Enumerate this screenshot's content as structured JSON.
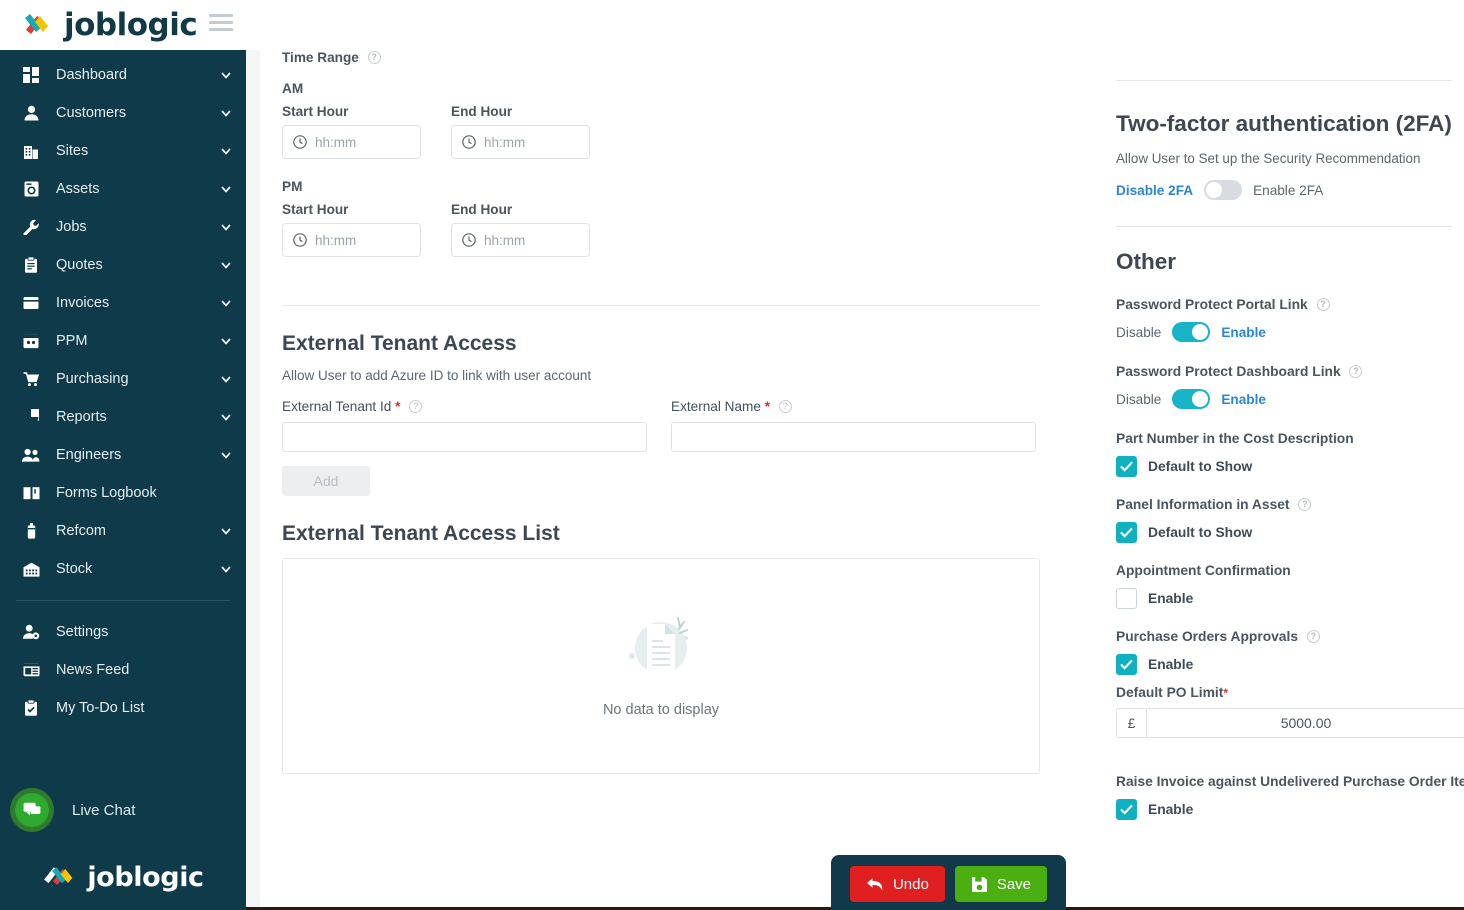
{
  "brand": {
    "name": "joblogic"
  },
  "topbar": {
    "menu_icon": "hamburger-icon"
  },
  "sidebar": {
    "items": [
      {
        "label": "Dashboard",
        "icon": "dashboard-icon",
        "expandable": true
      },
      {
        "label": "Customers",
        "icon": "user-icon",
        "expandable": true
      },
      {
        "label": "Sites",
        "icon": "building-icon",
        "expandable": true
      },
      {
        "label": "Assets",
        "icon": "asset-icon",
        "expandable": true
      },
      {
        "label": "Jobs",
        "icon": "wrench-icon",
        "expandable": true
      },
      {
        "label": "Quotes",
        "icon": "clipboard-icon",
        "expandable": true
      },
      {
        "label": "Invoices",
        "icon": "invoice-icon",
        "expandable": true
      },
      {
        "label": "PPM",
        "icon": "calendar-icon",
        "expandable": true
      },
      {
        "label": "Purchasing",
        "icon": "cart-icon",
        "expandable": true
      },
      {
        "label": "Reports",
        "icon": "pie-chart-icon",
        "expandable": true
      },
      {
        "label": "Engineers",
        "icon": "people-icon",
        "expandable": true
      },
      {
        "label": "Forms Logbook",
        "icon": "book-icon",
        "expandable": false
      },
      {
        "label": "Refcom",
        "icon": "cylinder-icon",
        "expandable": true
      },
      {
        "label": "Stock",
        "icon": "warehouse-icon",
        "expandable": true
      }
    ],
    "footer_items": [
      {
        "label": "Settings",
        "icon": "user-gear-icon",
        "expandable": false
      },
      {
        "label": "News Feed",
        "icon": "news-icon",
        "expandable": false
      },
      {
        "label": "My To-Do List",
        "icon": "todo-icon",
        "expandable": false
      }
    ],
    "live_chat": {
      "label": "Live Chat",
      "icon": "chat-icon"
    },
    "footer_logo": "joblogic"
  },
  "main": {
    "time_range": {
      "title": "Time Range",
      "am_label": "AM",
      "pm_label": "PM",
      "start_label": "Start Hour",
      "end_label": "End Hour",
      "placeholder": "hh:mm",
      "am_start_value": "",
      "am_end_value": "",
      "pm_start_value": "",
      "pm_end_value": ""
    },
    "external_tenant": {
      "title": "External Tenant Access",
      "subtitle": "Allow User to add Azure ID to link with user account",
      "tenant_id_label": "External Tenant Id",
      "tenant_id_value": "",
      "external_name_label": "External Name",
      "external_name_value": "",
      "required_marker": "*",
      "add_label": "Add"
    },
    "tenant_list": {
      "title": "External Tenant Access List",
      "empty_message": "No data to display",
      "empty_icon": "empty-document-icon"
    }
  },
  "right_panel": {
    "twofa": {
      "title": "Two-factor authentication (2FA)",
      "subtitle": "Allow User to Set up the Security Recommendation",
      "off_label": "Disable 2FA",
      "on_label": "Enable 2FA",
      "enabled": false
    },
    "other": {
      "title": "Other",
      "toggles": [
        {
          "label": "Password Protect Portal Link",
          "has_hint": true,
          "off_label": "Disable",
          "on_label": "Enable",
          "enabled": true
        },
        {
          "label": "Password Protect Dashboard Link",
          "has_hint": true,
          "off_label": "Disable",
          "on_label": "Enable",
          "enabled": true
        }
      ],
      "checkboxes": [
        {
          "label": "Part Number in the Cost Description",
          "has_hint": false,
          "option_label": "Default to Show",
          "checked": true
        },
        {
          "label": "Panel Information in Asset",
          "has_hint": true,
          "option_label": "Default to Show",
          "checked": true
        },
        {
          "label": "Appointment Confirmation",
          "has_hint": false,
          "option_label": "Enable",
          "checked": false
        },
        {
          "label": "Purchase Orders Approvals",
          "has_hint": true,
          "option_label": "Enable",
          "checked": true
        }
      ],
      "po_limit": {
        "label": "Default PO Limit",
        "required_marker": "*",
        "currency": "£",
        "value": "5000.00"
      },
      "raise_invoice": {
        "label": "Raise Invoice against Undelivered Purchase Order Item",
        "option_label": "Enable",
        "checked": true
      }
    }
  },
  "savebar": {
    "undo_label": "Undo",
    "save_label": "Save",
    "undo_icon": "undo-arrow-icon",
    "save_icon": "floppy-disk-icon"
  },
  "colors": {
    "sidebar_bg": "#0e3a4a",
    "brand_dark": "#113946",
    "toggle_on": "#17b3c7",
    "checkbox_on": "#0fb0bf",
    "link_blue": "#2a86d6",
    "undo_red": "#e02020",
    "save_green": "#4caf11",
    "required_red": "#d93025"
  }
}
